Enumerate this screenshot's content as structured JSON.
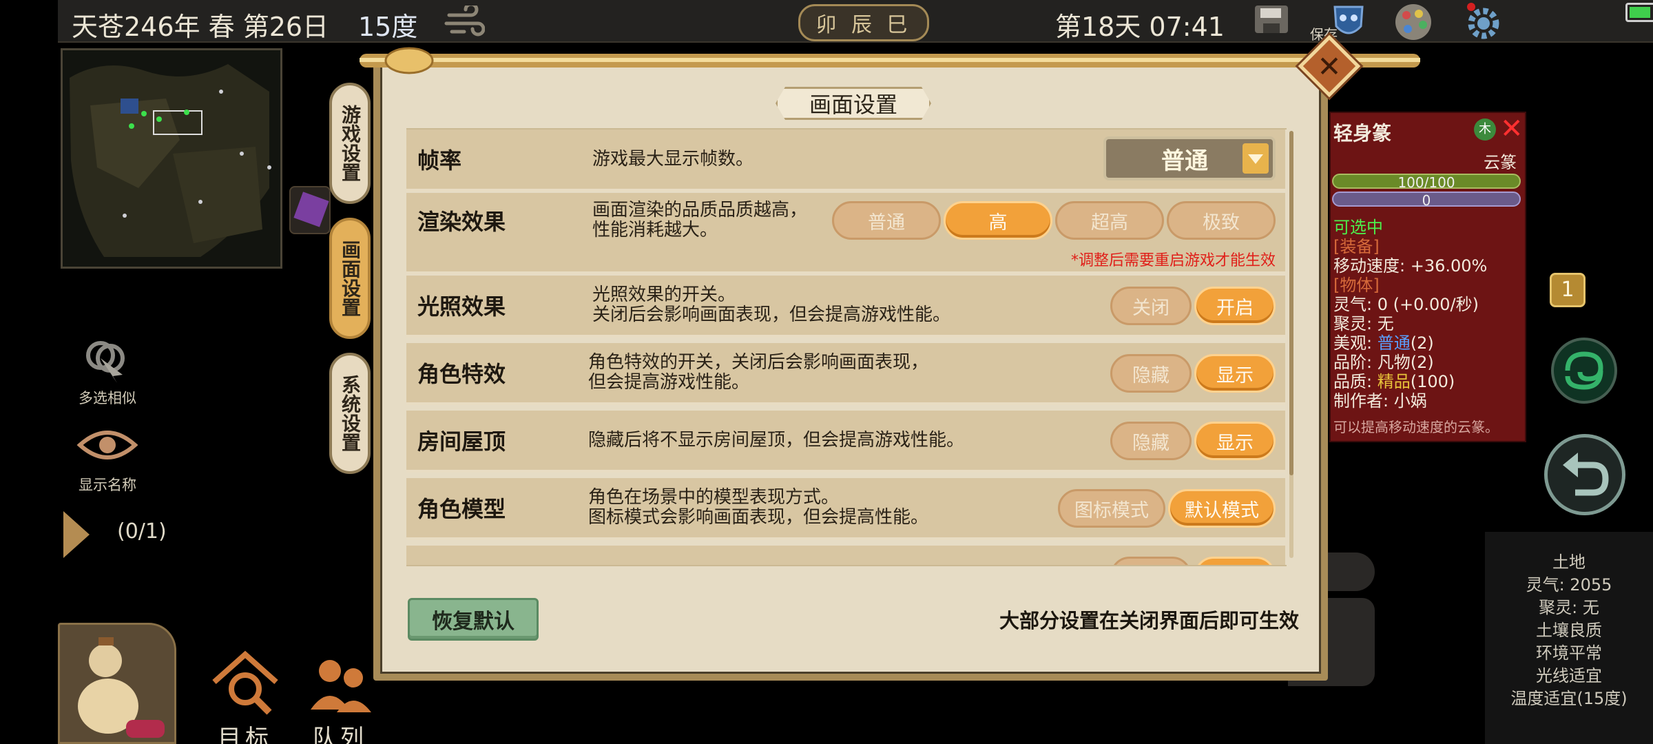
{
  "topbar": {
    "date": "天苍246年 春 第26日",
    "temperature": "15度",
    "weather_icon": "cloud-swirl-icon",
    "periods": "卯 辰 巳",
    "day_time": "第18天 07:41",
    "save_label": "保存",
    "icons": [
      "save-icon",
      "mask-icon",
      "palette-icon",
      "gear-icon"
    ],
    "battery_level": 0.8
  },
  "left_tools": {
    "multi_select_label": "多选相似",
    "show_names_label": "显示名称",
    "page_counter": "(0/1)"
  },
  "dock": {
    "target_label": "目标",
    "queue_label": "队列"
  },
  "item_panel": {
    "title": "轻身篆",
    "element_badge": "木",
    "category": "云篆",
    "hp_text": "100/100",
    "mp_text": "0",
    "lines": [
      "可选中",
      "[装备]",
      "移动速度: +36.00%",
      "[物体]",
      "灵气: 0 (+0.00/秒)",
      "聚灵: 无",
      "美观: ",
      "品阶: 凡物(2)",
      "品质: ",
      "制作者: 小娲",
      "可以提高移动速度的云篆。"
    ],
    "beauty_value": "普通",
    "beauty_suffix": "(2)",
    "quality_value": "精品",
    "quality_suffix": "(100)"
  },
  "chat_badge": "1",
  "terrain": {
    "lines": [
      "土地",
      "灵气: 2055",
      "聚灵: 无",
      "土壤良质",
      "环境平常",
      "光线适宜",
      "温度适宜(15度)"
    ]
  },
  "side_tabs": [
    "游戏设置",
    "画面设置",
    "系统设置"
  ],
  "active_tab": 1,
  "modal": {
    "title": "画面设置",
    "reset_label": "恢复默认",
    "footer_note": "大部分设置在关闭界面后即可生效",
    "restart_note": "*调整后需要重启游戏才能生效"
  },
  "settings": [
    {
      "name": "帧率",
      "desc": [
        "游戏最大显示帧数。"
      ],
      "type": "dropdown",
      "value": "普通"
    },
    {
      "name": "渲染效果",
      "desc": [
        "画面渲染的品质品质越高，",
        "性能消耗越大。"
      ],
      "type": "options",
      "options": [
        "普通",
        "高",
        "超高",
        "极致"
      ],
      "selected": 1
    },
    {
      "name": "光照效果",
      "desc": [
        "光照效果的开关。",
        "关闭后会影响画面表现，但会提高游戏性能。"
      ],
      "type": "options",
      "options": [
        "关闭",
        "开启"
      ],
      "selected": 1
    },
    {
      "name": "角色特效",
      "desc": [
        "角色特效的开关，关闭后会影响画面表现，",
        "但会提高游戏性能。"
      ],
      "type": "options",
      "options": [
        "隐藏",
        "显示"
      ],
      "selected": 1
    },
    {
      "name": "房间屋顶",
      "desc": [
        "隐藏后将不显示房间屋顶，但会提高游戏性能。"
      ],
      "type": "options",
      "options": [
        "隐藏",
        "显示"
      ],
      "selected": 1
    },
    {
      "name": "角色模型",
      "desc": [
        "角色在场景中的模型表现方式。",
        "图标模式会影响画面表现，但会提高性能。"
      ],
      "type": "options",
      "options": [
        "图标模式",
        "默认模式"
      ],
      "selected": 1
    }
  ]
}
